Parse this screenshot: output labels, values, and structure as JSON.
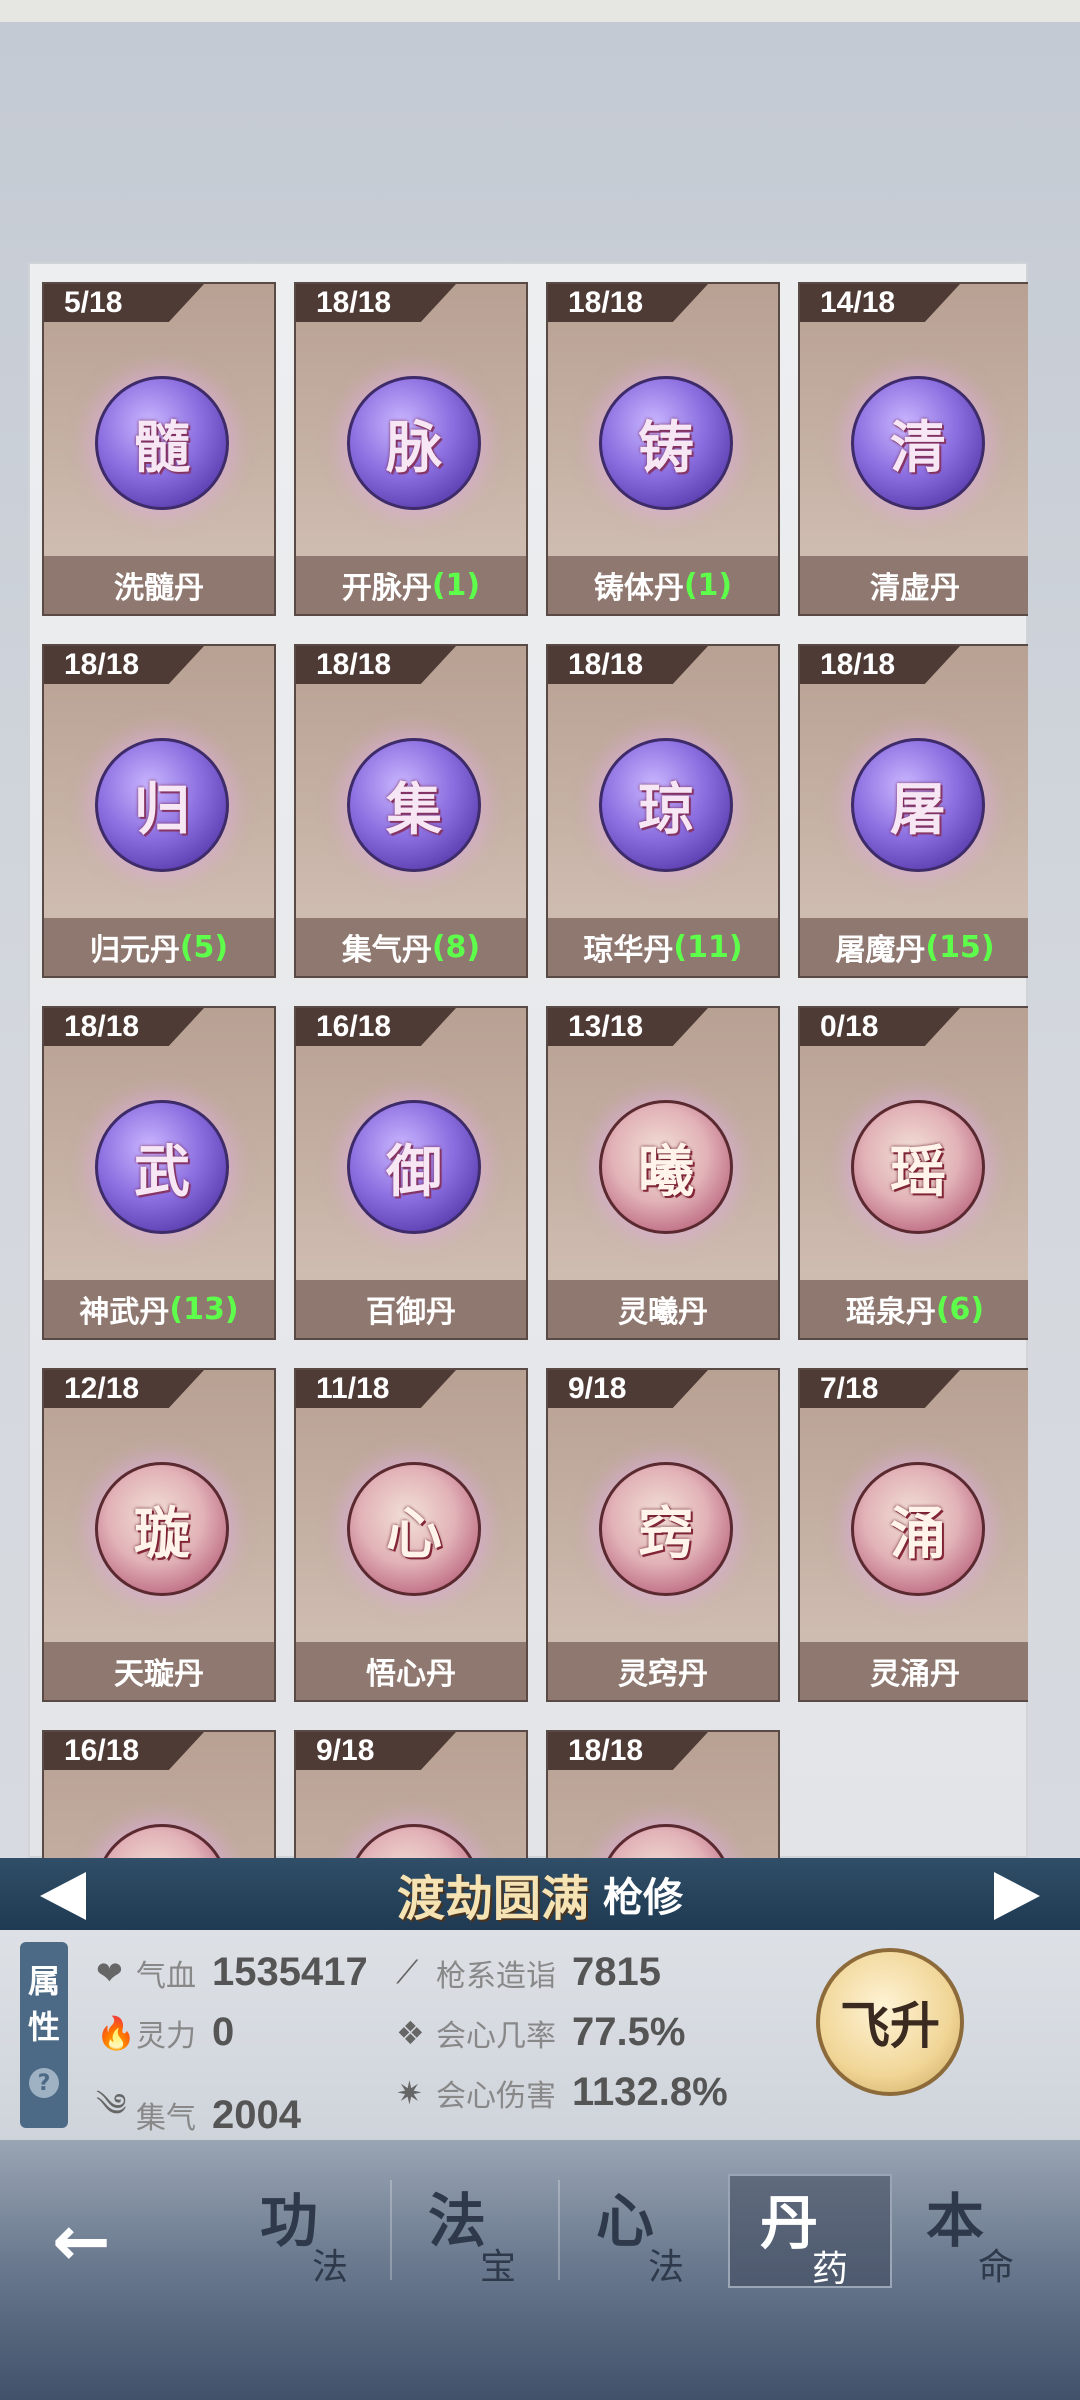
{
  "pills": [
    {
      "count": "5/18",
      "char": "髓",
      "name": "洗髓丹",
      "bonus": "",
      "orb": "purple"
    },
    {
      "count": "18/18",
      "char": "脉",
      "name": "开脉丹",
      "bonus": "(1)",
      "orb": "purple"
    },
    {
      "count": "18/18",
      "char": "铸",
      "name": "铸体丹",
      "bonus": "(1)",
      "orb": "purple"
    },
    {
      "count": "14/18",
      "char": "清",
      "name": "清虚丹",
      "bonus": "",
      "orb": "purple"
    },
    {
      "count": "18/18",
      "char": "归",
      "name": "归元丹",
      "bonus": "(5)",
      "orb": "purple"
    },
    {
      "count": "18/18",
      "char": "集",
      "name": "集气丹",
      "bonus": "(8)",
      "orb": "purple"
    },
    {
      "count": "18/18",
      "char": "琼",
      "name": "琼华丹",
      "bonus": "(11)",
      "orb": "purple"
    },
    {
      "count": "18/18",
      "char": "屠",
      "name": "屠魔丹",
      "bonus": "(15)",
      "orb": "purple"
    },
    {
      "count": "18/18",
      "char": "武",
      "name": "神武丹",
      "bonus": "(13)",
      "orb": "purple"
    },
    {
      "count": "16/18",
      "char": "御",
      "name": "百御丹",
      "bonus": "",
      "orb": "purple"
    },
    {
      "count": "13/18",
      "char": "曦",
      "name": "灵曦丹",
      "bonus": "",
      "orb": "pink"
    },
    {
      "count": "0/18",
      "char": "瑶",
      "name": "瑶泉丹",
      "bonus": "(6)",
      "orb": "pink"
    },
    {
      "count": "12/18",
      "char": "璇",
      "name": "天璇丹",
      "bonus": "",
      "orb": "pink"
    },
    {
      "count": "11/18",
      "char": "心",
      "name": "悟心丹",
      "bonus": "",
      "orb": "pink"
    },
    {
      "count": "9/18",
      "char": "窍",
      "name": "灵窍丹",
      "bonus": "",
      "orb": "pink"
    },
    {
      "count": "7/18",
      "char": "涌",
      "name": "灵涌丹",
      "bonus": "",
      "orb": "pink"
    },
    {
      "count": "16/18",
      "char": "",
      "name": "",
      "bonus": "",
      "orb": "pink"
    },
    {
      "count": "9/18",
      "char": "",
      "name": "",
      "bonus": "",
      "orb": "pink"
    },
    {
      "count": "18/18",
      "char": "",
      "name": "",
      "bonus": "",
      "orb": "pink"
    }
  ],
  "cultivation": {
    "realm": "渡劫圆满",
    "path": "枪修"
  },
  "attributes_tab": {
    "label_1": "属",
    "label_2": "性",
    "help": "?"
  },
  "stats": {
    "hp": {
      "label": "气血",
      "value": "1535417"
    },
    "spirit": {
      "label": "灵力",
      "value": "0"
    },
    "qi": {
      "label": "集气",
      "value": "2004"
    },
    "spear": {
      "label": "枪系造诣",
      "value": "7815"
    },
    "crit_rate": {
      "label": "会心几率",
      "value": "77.5%"
    },
    "crit_dmg": {
      "label": "会心伤害",
      "value": "1132.8%"
    }
  },
  "ascend_button": {
    "label": "飞升"
  },
  "nav": {
    "back": "←",
    "items": [
      {
        "big": "功",
        "small": "法"
      },
      {
        "big": "法",
        "small": "宝"
      },
      {
        "big": "心",
        "small": "法"
      },
      {
        "big": "丹",
        "small": "药"
      },
      {
        "big": "本",
        "small": "命"
      }
    ]
  },
  "colors": {
    "bonus": "#5dff4a",
    "bar": "#1f3a52",
    "realm": "#f6e3b4"
  }
}
